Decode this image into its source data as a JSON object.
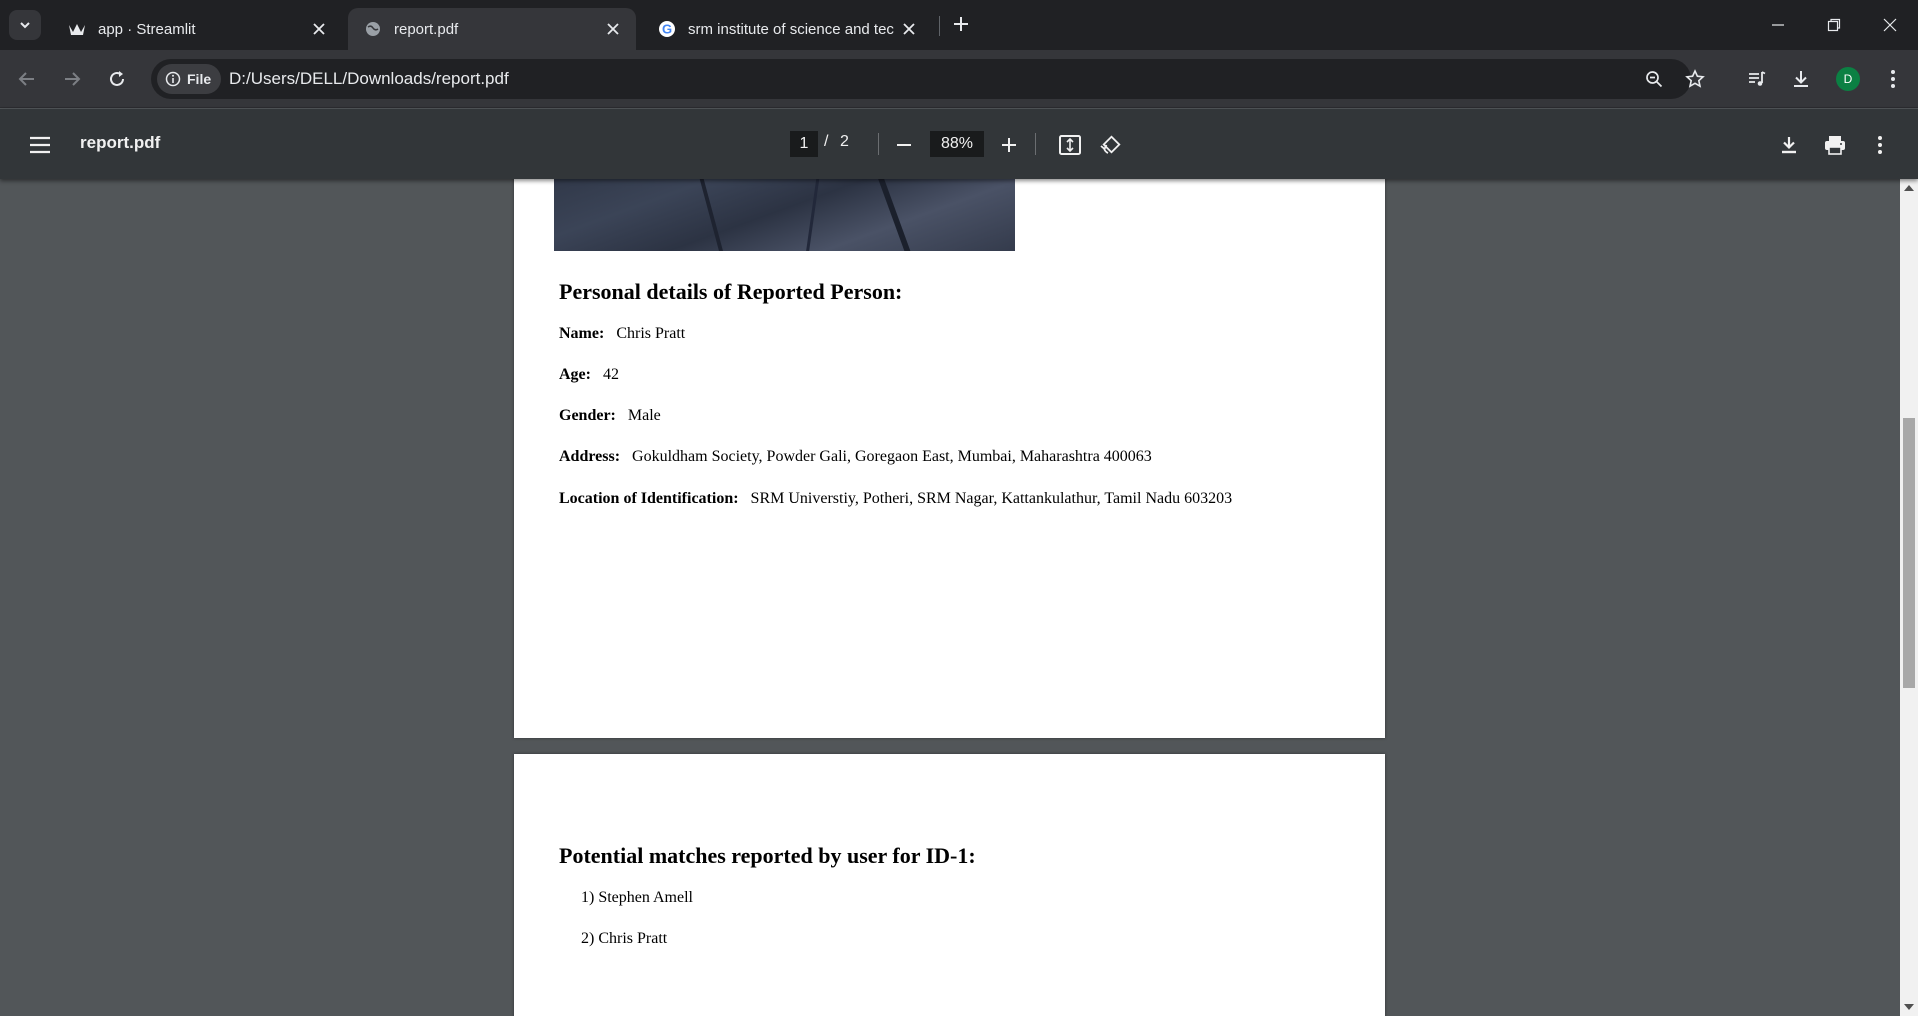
{
  "browser": {
    "tabs": [
      {
        "title": "app · Streamlit",
        "favicon": "streamlit-crown-icon",
        "active": false
      },
      {
        "title": "report.pdf",
        "favicon": "globe-icon",
        "active": true
      },
      {
        "title": "srm institute of science and tec",
        "favicon": "google-icon",
        "active": false
      }
    ],
    "address": {
      "chip_label": "File",
      "url": "D:/Users/DELL/Downloads/report.pdf"
    },
    "profile_initial": "D",
    "profile_color": "#0b8043"
  },
  "pdf_toolbar": {
    "title": "report.pdf",
    "current_page": "1",
    "page_separator": "/",
    "total_pages": "2",
    "zoom": "88%"
  },
  "report": {
    "personal_heading": "Personal details of Reported Person:",
    "fields": [
      {
        "label": "Name:",
        "value": "Chris Pratt"
      },
      {
        "label": "Age:",
        "value": "42"
      },
      {
        "label": "Gender:",
        "value": "Male"
      },
      {
        "label": "Address:",
        "value": "Gokuldham Society, Powder Gali, Goregaon East, Mumbai, Maharashtra 400063"
      },
      {
        "label": "Location of Identification:",
        "value": "SRM Universtiy, Potheri, SRM Nagar, Kattankulathur, Tamil Nadu 603203"
      }
    ],
    "matches_heading": "Potential matches reported by user for ID-1:",
    "matches": [
      "1) Stephen Amell",
      "2) Chris Pratt"
    ]
  },
  "colors": {
    "tabstrip": "#202124",
    "toolbar": "#35363a",
    "pdf_toolbar": "#323639",
    "viewer_bg": "#525659"
  }
}
